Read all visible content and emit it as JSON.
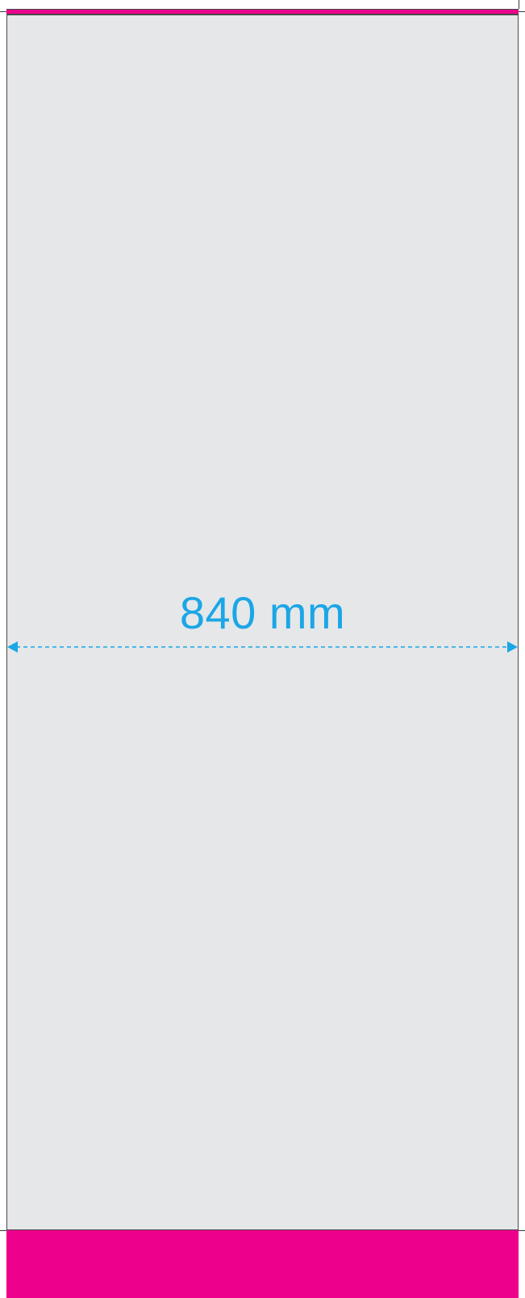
{
  "template": {
    "dimension_label": "840 mm"
  },
  "colors": {
    "sheet_fill": "#e5e7e9",
    "accent_magenta": "#ec008c",
    "dimension_blue": "#1ba6e6",
    "outline": "#4a4a4a"
  }
}
